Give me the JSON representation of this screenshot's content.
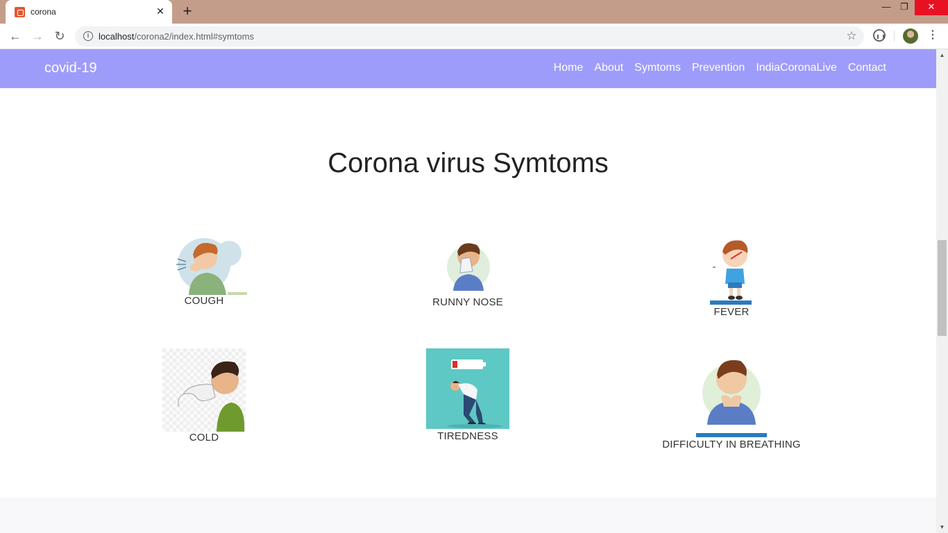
{
  "browser": {
    "tab_title": "corona",
    "tab_close": "✕",
    "new_tab": "+",
    "url_host": "localhost",
    "url_path": "/corona2/index.html#symtoms",
    "controls": {
      "minimize": "—",
      "maximize": "❐",
      "close": "✕"
    }
  },
  "navbar": {
    "brand": "covid-19",
    "links": [
      "Home",
      "About",
      "Symtoms",
      "Prevention",
      "IndiaCoronaLive",
      "Contact"
    ]
  },
  "section": {
    "title": "Corona virus Symtoms"
  },
  "symptoms": [
    {
      "label": "COUGH",
      "icon": "coughing-person-icon"
    },
    {
      "label": "RUNNY NOSE",
      "icon": "tissue-nose-icon"
    },
    {
      "label": "FEVER",
      "icon": "fever-child-icon"
    },
    {
      "label": "COLD",
      "icon": "sneezing-person-icon"
    },
    {
      "label": "TIREDNESS",
      "icon": "tired-person-low-battery-icon"
    },
    {
      "label": "DIFFICULTY IN BREATHING",
      "icon": "breathless-person-icon"
    }
  ],
  "colors": {
    "navbar": "#9e9cfa",
    "titlebar": "#c49c8a",
    "tiredness_bg": "#5ec8c4"
  }
}
